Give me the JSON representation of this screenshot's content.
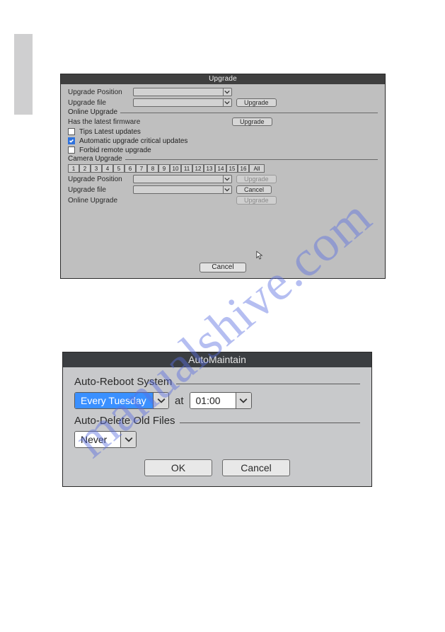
{
  "watermark": "manualshive.com",
  "upgrade": {
    "title": "Upgrade",
    "labels": {
      "position": "Upgrade Position",
      "file": "Upgrade file",
      "online_header": "Online Upgrade",
      "has_latest": "Has the latest firmware",
      "tips": "Tips Latest updates",
      "auto_crit": "Automatic upgrade critical updates",
      "forbid": "Forbid remote upgrade",
      "camera_header": "Camera Upgrade"
    },
    "selects": {
      "position": "",
      "file": "",
      "cam_position": "",
      "cam_file": ""
    },
    "buttons": {
      "upgrade": "Upgrade",
      "cancel": "Cancel",
      "cancel_footer": "Cancel"
    },
    "checks": {
      "tips": false,
      "auto_crit": true,
      "forbid": false
    },
    "camera_channels": [
      "1",
      "2",
      "3",
      "4",
      "5",
      "6",
      "7",
      "8",
      "9",
      "10",
      "11",
      "12",
      "13",
      "14",
      "15",
      "16",
      "All"
    ]
  },
  "automaintain": {
    "title": "AutoMaintain",
    "labels": {
      "reboot_header": "Auto-Reboot System",
      "delete_header": "Auto-Delete Old Files",
      "at": "at"
    },
    "selects": {
      "reboot_day": "Every Tuesday",
      "reboot_time": "01:00",
      "delete": "Never"
    },
    "buttons": {
      "ok": "OK",
      "cancel": "Cancel"
    }
  }
}
